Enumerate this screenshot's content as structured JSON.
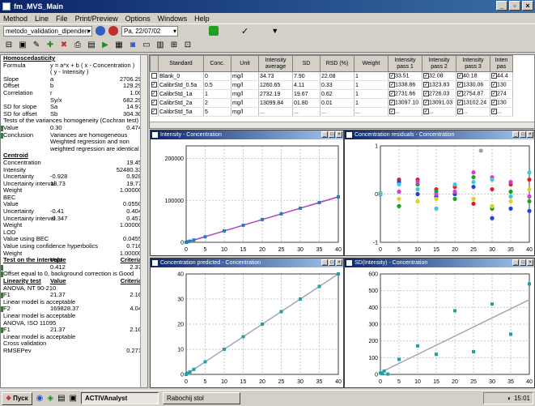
{
  "window": {
    "title": "fm_MVS_Main"
  },
  "menu": [
    "Method",
    "Line",
    "File",
    "Print/Preview",
    "Options",
    "Windows",
    "Help"
  ],
  "toolbar": {
    "method_combo": "metodo_validation_dipenden",
    "date_combo": "Pa, 22/07/02"
  },
  "left_panel": {
    "rows": [
      {
        "a": "Homoscedasticity",
        "b": "",
        "c": "",
        "style": "head"
      },
      {
        "a": "Formula",
        "b": "y = a*x + b ( x - Concentration )",
        "c": ""
      },
      {
        "a": "",
        "b": "( y - Intensity )",
        "c": ""
      },
      {
        "a": "Slope",
        "b": "a",
        "c": "2706.29"
      },
      {
        "a": "Offset",
        "b": "b",
        "c": "129.29"
      },
      {
        "a": "Correlation",
        "b": "r",
        "c": "1.00"
      },
      {
        "a": "",
        "b": "Sy/x",
        "c": "682.29"
      },
      {
        "a": "SD for slope",
        "b": "Sa",
        "c": "14.97"
      },
      {
        "a": "SD for offset",
        "b": "Sb",
        "c": "304.30"
      },
      {
        "a": "Tests of the variances homogeneity (Cochran test)",
        "b": "",
        "c": ""
      },
      {
        "a": "Value",
        "b": "0.30",
        "c": "0.474",
        "style": "green"
      },
      {
        "a": "Conclusion",
        "b": "Variances are homogeneous",
        "c": "",
        "style": "green"
      },
      {
        "a": "",
        "b": "Weighted regression and non",
        "c": ""
      },
      {
        "a": "",
        "b": "weighted regression are identical",
        "c": ""
      },
      {
        "a": "Centroid",
        "b": "",
        "c": "",
        "style": "head"
      },
      {
        "a": "Concentration",
        "b": "",
        "c": "19.45"
      },
      {
        "a": "Intensity",
        "b": "",
        "c": "52480.33"
      },
      {
        "a": "Uncertainty",
        "b": "-0.928",
        "c": "0.928"
      },
      {
        "a": "Uncertainty interval",
        "b": "18.73",
        "c": "19.77"
      },
      {
        "a": "Weight",
        "b": "",
        "c": "1.00000"
      },
      {
        "a": "BEC",
        "b": "",
        "c": ""
      },
      {
        "a": "Value",
        "b": "",
        "c": "0.0550"
      },
      {
        "a": "Uncertainty",
        "b": "-0.41",
        "c": "0.404"
      },
      {
        "a": "Uncertainty interval",
        "b": "-0.347",
        "c": "0.457"
      },
      {
        "a": "Weight",
        "b": "",
        "c": "1.00000"
      },
      {
        "a": "LOD",
        "b": "",
        "c": ""
      },
      {
        "a": "Value using BEC",
        "b": "",
        "c": "0.0455"
      },
      {
        "a": "Value using confidence hyperbolics",
        "b": "",
        "c": "0.716"
      },
      {
        "a": "Weight",
        "b": "",
        "c": "1.00000"
      },
      {
        "a": "Test on the intercept",
        "b": "Value",
        "c": "Criteria",
        "style": "head"
      },
      {
        "a": "",
        "b": "0.412",
        "c": "2.37",
        "style": "green"
      },
      {
        "a": "Offset equal to 0, background correction is Good",
        "b": "",
        "c": "",
        "style": "green"
      },
      {
        "a": "Linearity test",
        "b": "Value",
        "c": "Criteria",
        "style": "head"
      },
      {
        "a": "ANOVA, NT 90-210",
        "b": "",
        "c": ""
      },
      {
        "a": "F1",
        "b": "21.37",
        "c": "2.16",
        "style": "green"
      },
      {
        "a": "Linear model is acceptable",
        "b": "",
        "c": ""
      },
      {
        "a": "F2",
        "b": "169828.37",
        "c": "4.04",
        "style": "green"
      },
      {
        "a": "Linear model is acceptable",
        "b": "",
        "c": ""
      },
      {
        "a": "ANOVA, ISO 11095",
        "b": "",
        "c": ""
      },
      {
        "a": "F1",
        "b": "21.37",
        "c": "2.10",
        "style": "green"
      },
      {
        "a": "Linear model is acceptable",
        "b": "",
        "c": ""
      },
      {
        "a": "Cross validation",
        "b": "",
        "c": ""
      },
      {
        "a": "RMSEPev",
        "b": "",
        "c": "0.271"
      }
    ]
  },
  "table": {
    "columns": [
      "",
      "Standard",
      "Conc.",
      "Unit",
      "Intensity average",
      "SD",
      "RSD (%)",
      "Weight",
      "Intensity pass 1",
      "Intensity pass 2",
      "Intensity pass 3",
      "Inten pas"
    ],
    "rows": [
      [
        "",
        "Blank_0",
        "0",
        "mg/l",
        "34.73",
        "7.90",
        "22.08",
        "1",
        "33.51",
        "32.08",
        "40.18",
        "44.4"
      ],
      [
        "✓",
        "CalibrStd_0.5a",
        "0.5",
        "mg/l",
        "1260.65",
        "4.11",
        "0.33",
        "1",
        "1338.86",
        "1323.83",
        "1330.06",
        "130"
      ],
      [
        "✓",
        "CalibrStd_1a",
        "1",
        "mg/l",
        "2732.19",
        "19.67",
        "0.62",
        "1",
        "2731.66",
        "2726.03",
        "2754.87",
        "274"
      ],
      [
        "✓",
        "CalibrStd_2a",
        "2",
        "mg/l",
        "13099.84",
        "01.80",
        "0.01",
        "1",
        "13097.10",
        "13091.03",
        "13102.24",
        "130"
      ],
      [
        "✓",
        "CalibrStd_5a",
        "5",
        "mg/l",
        "...",
        "...",
        "...",
        "...",
        "...",
        "...",
        "...",
        "..."
      ]
    ]
  },
  "charts": [
    {
      "title": "Intensity - Concentration",
      "chart_data": {
        "type": "scatter",
        "x": [
          0,
          0.5,
          1,
          2,
          5,
          10,
          15,
          20,
          25,
          30,
          35,
          40
        ],
        "y": [
          35,
          1261,
          2732,
          5420,
          13100,
          27200,
          40700,
          54300,
          67800,
          81300,
          94800,
          108400
        ],
        "xlim": [
          0,
          40
        ],
        "ylim": [
          0,
          230000
        ],
        "xticks": [
          0,
          5,
          10,
          15,
          20,
          25,
          30,
          35,
          40
        ],
        "yticks": [
          0,
          100000,
          200000
        ],
        "fit_line": true
      }
    },
    {
      "title": "Concentration residuals - Concentration",
      "chart_data": {
        "type": "scatter",
        "xlim": [
          0,
          40
        ],
        "ylim": [
          -1.0,
          1.0
        ],
        "xticks": [
          0,
          5,
          10,
          15,
          20,
          25,
          30,
          35,
          40
        ],
        "yticks": [
          -1.0,
          0.0,
          1.0
        ],
        "series": [
          {
            "color": "#e02020",
            "points": [
              [
                0,
                0.0
              ],
              [
                5,
                0.3
              ],
              [
                10,
                0.3
              ],
              [
                15,
                0.1
              ],
              [
                20,
                0.15
              ],
              [
                25,
                -0.2
              ],
              [
                30,
                0.1
              ],
              [
                35,
                0.2
              ],
              [
                40,
                0.3
              ]
            ]
          },
          {
            "color": "#20a020",
            "points": [
              [
                0,
                0.02
              ],
              [
                5,
                -0.25
              ],
              [
                10,
                0.2
              ],
              [
                15,
                0.05
              ],
              [
                20,
                -0.1
              ],
              [
                25,
                0.35
              ],
              [
                30,
                -0.3
              ],
              [
                35,
                0.05
              ],
              [
                40,
                -0.15
              ]
            ]
          },
          {
            "color": "#2040e0",
            "points": [
              [
                0,
                0.0
              ],
              [
                5,
                0.25
              ],
              [
                10,
                0.0
              ],
              [
                15,
                -0.05
              ],
              [
                20,
                0.0
              ],
              [
                25,
                0.15
              ],
              [
                30,
                -0.5
              ],
              [
                35,
                -0.3
              ],
              [
                40,
                -0.35
              ]
            ]
          },
          {
            "color": "#e0d020",
            "points": [
              [
                0,
                0.01
              ],
              [
                5,
                -0.1
              ],
              [
                10,
                -0.15
              ],
              [
                15,
                -0.1
              ],
              [
                20,
                0.05
              ],
              [
                25,
                -0.1
              ],
              [
                30,
                -0.25
              ],
              [
                35,
                -0.15
              ],
              [
                40,
                0.1
              ]
            ]
          },
          {
            "color": "#d040d0",
            "points": [
              [
                0,
                -0.01
              ],
              [
                5,
                0.05
              ],
              [
                10,
                0.25
              ],
              [
                15,
                0.0
              ],
              [
                20,
                0.05
              ],
              [
                25,
                0.45
              ],
              [
                30,
                0.35
              ],
              [
                35,
                0.25
              ],
              [
                40,
                -0.05
              ]
            ]
          },
          {
            "color": "#40c8e0",
            "points": [
              [
                0,
                0.0
              ],
              [
                5,
                0.2
              ],
              [
                10,
                0.1
              ],
              [
                15,
                -0.3
              ],
              [
                20,
                0.2
              ],
              [
                25,
                0.25
              ],
              [
                30,
                0.3
              ],
              [
                35,
                -0.05
              ],
              [
                40,
                0.45
              ]
            ]
          },
          {
            "color": "#a0a0a0",
            "points": [
              [
                27,
                0.9
              ]
            ]
          }
        ]
      }
    },
    {
      "title": "Concentration predicted - Concentration",
      "chart_data": {
        "type": "scatter",
        "x": [
          0,
          0.5,
          1,
          2,
          5,
          10,
          15,
          20,
          25,
          30,
          35,
          40
        ],
        "y": [
          0,
          0.5,
          1,
          2,
          5,
          10,
          15,
          20,
          25,
          30,
          35,
          40
        ],
        "xlim": [
          0,
          40
        ],
        "ylim": [
          0,
          40
        ],
        "xticks": [
          0,
          5,
          10,
          15,
          20,
          25,
          30,
          35,
          40
        ],
        "yticks": [
          0,
          10,
          20,
          30,
          40
        ],
        "fit_line": true
      }
    },
    {
      "title": "SD(Intensity) - Concentration",
      "chart_data": {
        "type": "scatter",
        "x": [
          0,
          0.5,
          1,
          2,
          5,
          10,
          15,
          20,
          25,
          30,
          35,
          40
        ],
        "y": [
          8,
          4,
          20,
          2,
          90,
          170,
          120,
          380,
          135,
          420,
          240,
          540
        ],
        "xlim": [
          0,
          40
        ],
        "ylim": [
          0,
          600
        ],
        "xticks": [
          0,
          5,
          10,
          15,
          20,
          25,
          30,
          35,
          40
        ],
        "yticks": [
          0,
          100,
          200,
          300,
          400,
          500,
          600
        ],
        "fit_line": true
      }
    }
  ],
  "taskbar": {
    "start": "Пуск",
    "items": [
      "ACTIVAnalyst",
      "Rabochij stol"
    ],
    "clock": "15:01"
  }
}
